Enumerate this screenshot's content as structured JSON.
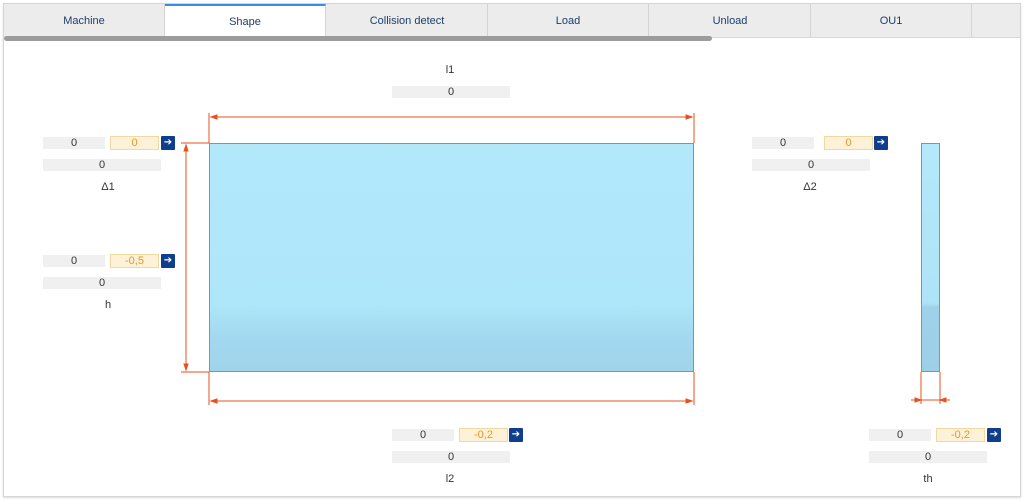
{
  "tabs": [
    {
      "label": "Machine"
    },
    {
      "label": "Shape"
    },
    {
      "label": "Collision detect"
    },
    {
      "label": "Load"
    },
    {
      "label": "Unload"
    },
    {
      "label": "OU1"
    }
  ],
  "active_tab": "Shape",
  "dims": {
    "l1": {
      "label": "l1",
      "value": "0"
    },
    "delta1": {
      "label": "Δ1",
      "current": "0",
      "input": "0",
      "value": "0"
    },
    "delta2": {
      "label": "Δ2",
      "current": "0",
      "input": "0",
      "value": "0"
    },
    "h": {
      "label": "h",
      "current": "0",
      "input": "-0,5",
      "value": "0"
    },
    "l2": {
      "label": "l2",
      "current": "0",
      "input": "-0,2",
      "value": "0"
    },
    "th": {
      "label": "th",
      "current": "0",
      "input": "-0,2",
      "value": "0"
    }
  },
  "colors": {
    "accent": "#0f3f8c",
    "dimension_line": "#e8501e",
    "panel": "#b3e8fb",
    "input_text": "#e8962a"
  },
  "icons": {
    "go": "arrow-right-icon"
  }
}
